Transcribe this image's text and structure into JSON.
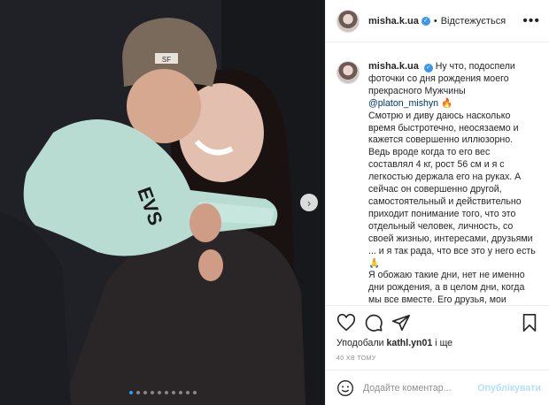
{
  "photo": {
    "cap_text": "SF",
    "sleeve_text": "EVS",
    "carousel": {
      "count": 10,
      "active_index": 0
    }
  },
  "header": {
    "username": "misha.k.ua",
    "separator": "•",
    "follow_label": "Відстежується",
    "more_label": "•••"
  },
  "caption": {
    "username": "misha.k.ua",
    "text_intro": "Ну что, подоспели фоточки со дня рождения моего прекрасного Мужчины",
    "mention": "@platon_mishyn",
    "emoji1": "🔥",
    "text_body": "Смотрю и диву даюсь насколько время быстротечно, неосязаемо и кажется совершенно иллюзорно. Ведь вроде когда то его вес составлял 4 кг, рост 56 см и я с легкостью держала его на руках. А сейчас он совершенно другой, самостоятельный и действительно приходит понимание того, что это отдельный человек, личность, со своей жизнью, интересами, друзьями ... и я так рада, что все это у него есть",
    "emoji2": "🙏",
    "text_tail": "Я обожаю такие дни, нет не именно дни рождения, а в целом дни, когда мы все вместе. Его друзья, мои друзья"
  },
  "actions": {
    "likes_prefix": "Уподобали",
    "likes_user": "kathl.yn01",
    "likes_suffix": "і ще",
    "timestamp": "40 ХВ ТОМУ"
  },
  "comment": {
    "placeholder": "Додайте коментар...",
    "publish_label": "Опублікувати"
  },
  "colors": {
    "accent": "#3897f0",
    "publish_disabled": "#b2dffc",
    "muted": "#8e8e8e"
  }
}
